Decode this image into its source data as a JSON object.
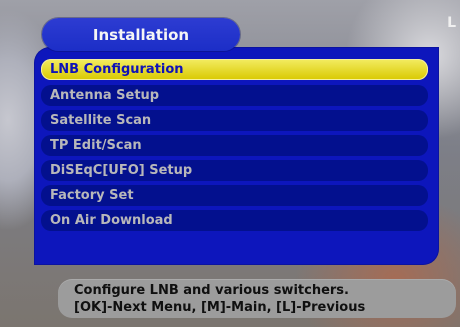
{
  "page": {
    "edge_text": "L"
  },
  "menu": {
    "title": "Installation",
    "items": [
      {
        "label": "LNB Configuration",
        "selected": true
      },
      {
        "label": "Antenna Setup",
        "selected": false
      },
      {
        "label": "Satellite Scan",
        "selected": false
      },
      {
        "label": "TP Edit/Scan",
        "selected": false
      },
      {
        "label": "DiSEqC[UFO] Setup",
        "selected": false
      },
      {
        "label": "Factory Set",
        "selected": false
      },
      {
        "label": "On Air Download",
        "selected": false
      }
    ]
  },
  "help": {
    "line1": "Configure LNB and various switchers.",
    "line2": "[OK]-Next Menu, [M]-Main, [L]-Previous"
  },
  "colors": {
    "panel_blue": "#0d16bc",
    "item_blue": "#03108e",
    "selected_yellow": "#d9c900",
    "help_gray": "#9c9c9c"
  }
}
